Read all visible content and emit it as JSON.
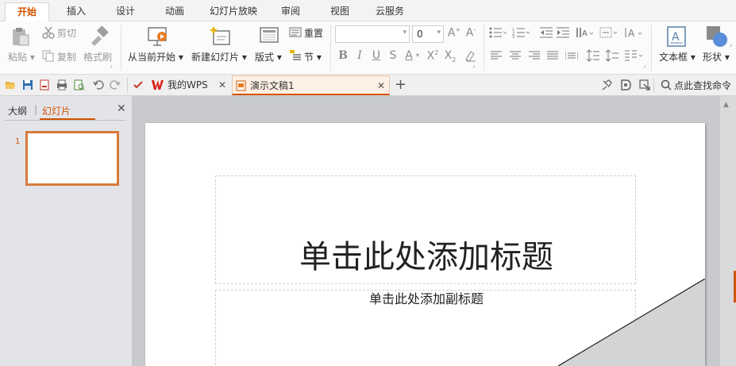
{
  "menubar": {
    "tabs": [
      {
        "label": "开始",
        "active": true
      },
      {
        "label": "插入"
      },
      {
        "label": "设计"
      },
      {
        "label": "动画"
      },
      {
        "label": "幻灯片放映"
      },
      {
        "label": "审阅"
      },
      {
        "label": "视图"
      },
      {
        "label": "云服务"
      }
    ]
  },
  "ribbon": {
    "paste": "粘贴",
    "cut": "剪切",
    "copy": "复制",
    "format_painter": "格式刷",
    "from_current": "从当前开始",
    "new_slide": "新建幻灯片",
    "layout": "版式",
    "reset": "重置",
    "section": "节",
    "font_size": "0",
    "text_box": "文本框",
    "shape": "形状"
  },
  "quickbar": {
    "doc_tabs": [
      {
        "label": "我的WPS"
      },
      {
        "label": "演示文稿1",
        "active": true
      }
    ],
    "search": "点此查找命令"
  },
  "left_panel": {
    "tab_outline": "大纲",
    "tab_slides": "幻灯片",
    "slide_number": "1"
  },
  "slide": {
    "title_placeholder": "单击此处添加标题",
    "subtitle_placeholder": "单击此处添加副标题"
  },
  "colors": {
    "accent": "#d35400",
    "wps_red": "#d9241c"
  }
}
